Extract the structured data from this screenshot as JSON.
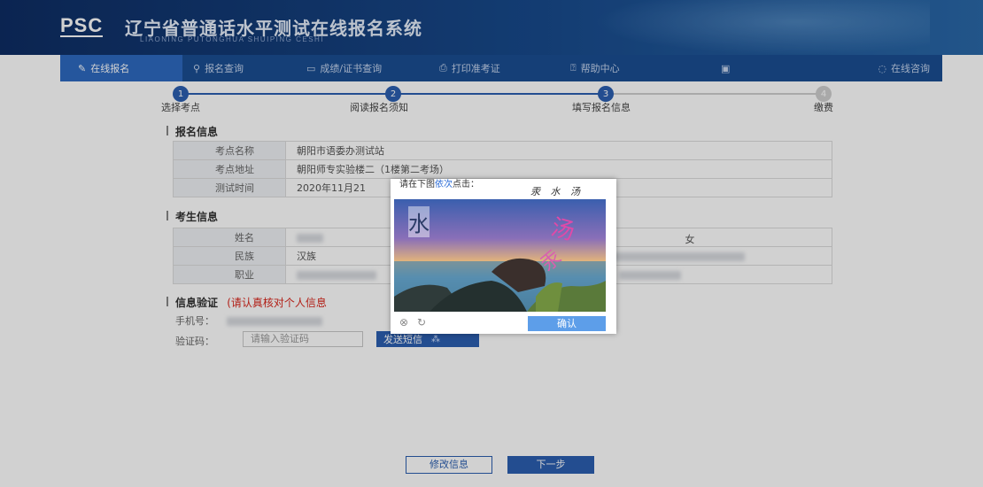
{
  "header": {
    "logo": "PSC",
    "title": "辽宁省普通话水平测试在线报名系统",
    "subtitle": "LIAONING PUTONGHUA SHUIPING CESHI"
  },
  "nav": {
    "items": [
      {
        "icon": "edit-icon",
        "label": "在线报名",
        "active": true
      },
      {
        "icon": "search-icon",
        "label": "报名查询"
      },
      {
        "icon": "certificate-icon",
        "label": "成绩/证书查询"
      },
      {
        "icon": "printer-icon",
        "label": "打印准考证"
      },
      {
        "icon": "help-icon",
        "label": "帮助中心"
      },
      {
        "icon": "document-icon",
        "label": ""
      },
      {
        "icon": "chat-icon",
        "label": "在线咨询"
      }
    ]
  },
  "steps": [
    {
      "num": "1",
      "label": "选择考点"
    },
    {
      "num": "2",
      "label": "阅读报名须知"
    },
    {
      "num": "3",
      "label": "填写报名信息"
    },
    {
      "num": "4",
      "label": "缴费"
    }
  ],
  "registration": {
    "section_title": "报名信息",
    "rows": [
      {
        "key": "考点名称",
        "value": "朝阳市语委办测试站"
      },
      {
        "key": "考点地址",
        "value": "朝阳师专实验楼二（1楼第二考场）"
      },
      {
        "key": "测试时间",
        "value": "2020年11月21"
      }
    ]
  },
  "candidate": {
    "section_title": "考生信息",
    "rows": [
      {
        "key": "姓名",
        "value": "",
        "extra": "女"
      },
      {
        "key": "民族",
        "value": "汉族",
        "extra": ""
      },
      {
        "key": "职业",
        "value": "",
        "extra": ""
      }
    ]
  },
  "verify": {
    "section_title": "信息验证",
    "warning": "(请认真核对个人信息",
    "phone_label": "手机号：",
    "code_label": "验证码：",
    "code_placeholder": "请输入验证码",
    "sms_button": "发送短信"
  },
  "buttons": {
    "modify": "修改信息",
    "next": "下一步"
  },
  "captcha": {
    "prompt_prefix": "请在下图",
    "prompt_highlight": "依次",
    "prompt_suffix": "点击：",
    "chars": "汞 水 汤",
    "img_chars": [
      "水",
      "汤",
      "汞"
    ],
    "confirm": "确认"
  },
  "colors": {
    "primary": "#2b5fb0",
    "header": "#0e2d63",
    "warning": "#d9261c"
  }
}
